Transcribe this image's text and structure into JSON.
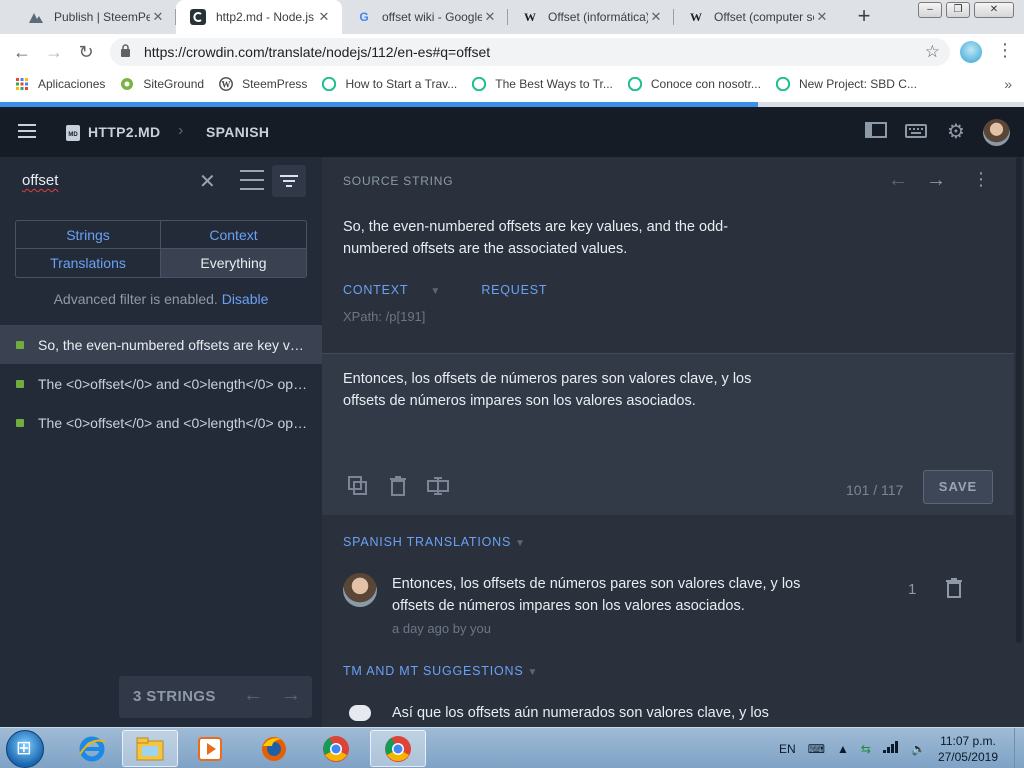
{
  "browser": {
    "tabs": [
      {
        "title": "Publish | SteemPeak",
        "icon": "steempeak-icon",
        "active": false
      },
      {
        "title": "http2.md - Node.js",
        "icon": "crowdin-icon",
        "active": true
      },
      {
        "title": "offset wiki - Google",
        "icon": "google-icon",
        "active": false
      },
      {
        "title": "Offset (informática)",
        "icon": "wikipedia-icon",
        "active": false
      },
      {
        "title": "Offset (computer science)",
        "icon": "wikipedia-icon",
        "active": false
      }
    ],
    "url": "https://crowdin.com/translate/nodejs/112/en-es#q=offset",
    "bookmarks": [
      {
        "label": "Aplicaciones",
        "icon": "apps-grid-icon"
      },
      {
        "label": "SiteGround",
        "icon": "siteground-icon"
      },
      {
        "label": "SteemPress",
        "icon": "wordpress-icon"
      },
      {
        "label": "How to Start a Trav...",
        "icon": "steem-icon"
      },
      {
        "label": "The Best Ways to Tr...",
        "icon": "steem-icon"
      },
      {
        "label": "Conoce con nosotr...",
        "icon": "steem-icon"
      },
      {
        "label": "New Project: SBD C...",
        "icon": "steem-icon"
      }
    ],
    "bookmarks_overflow": "»",
    "load_progress": 0.74
  },
  "app": {
    "file": "HTTP2.MD",
    "language": "SPANISH",
    "file_badge": "MD"
  },
  "sidebar": {
    "search_value": "offset",
    "filters": [
      {
        "label": "Strings",
        "selected": false
      },
      {
        "label": "Context",
        "selected": false
      },
      {
        "label": "Translations",
        "selected": false
      },
      {
        "label": "Everything",
        "selected": true
      }
    ],
    "advanced_filter_text": "Advanced filter is enabled.",
    "advanced_filter_link": "Disable",
    "strings": [
      {
        "text": "So, the even-numbered offsets are key values, and the odd-numbered offsets are the associated values.",
        "selected": true
      },
      {
        "text": "The <0>offset</0> and <0>length</0> options...",
        "selected": false
      },
      {
        "text": "The <0>offset</0> and <0>length</0> options...",
        "selected": false
      }
    ],
    "strings_count": "3 STRINGS"
  },
  "editor": {
    "source_label": "SOURCE STRING",
    "source_text": "So, the even-numbered offsets are key values, and the odd-numbered offsets are the associated values.",
    "context_tab": "CONTEXT",
    "request_tab": "REQUEST",
    "xpath": "XPath: /p[191]",
    "translation_text": "Entonces, los offsets de números pares son valores clave, y los offsets de números impares son los valores asociados.",
    "char_count": "101 / 117",
    "save_label": "SAVE",
    "translations_label": "SPANISH TRANSLATIONS",
    "translation_item": {
      "text": "Entonces, los offsets de números pares son valores clave, y los offsets de números impares son los valores asociados.",
      "meta": "a day ago by you",
      "votes": "1"
    },
    "tm_label": "TM AND MT SUGGESTIONS",
    "tm_item_text": "Así que los offsets aún numerados son valores clave, y los"
  },
  "taskbar": {
    "language": "EN",
    "time": "11:07 p.m.",
    "date": "27/05/2019"
  }
}
